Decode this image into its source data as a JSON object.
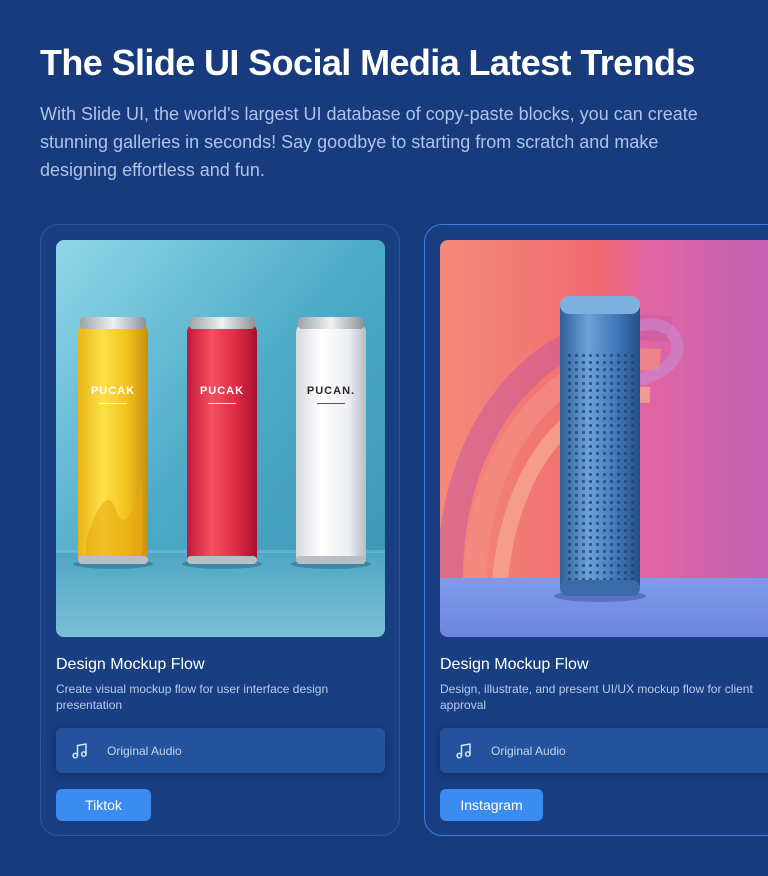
{
  "header": {
    "title": "The Slide UI Social Media Latest Trends",
    "description": "With Slide UI, the world's largest UI database of copy-paste blocks, you can create stunning galleries in seconds! Say goodbye to starting from scratch and make designing effortless and fun."
  },
  "cards": [
    {
      "title": "Design Mockup Flow",
      "description": "Create visual mockup flow for user interface design presentation",
      "audio_label": "Original Audio",
      "tag_label": "Tiktok",
      "image_labels": [
        "PUCAK",
        "PUCAK",
        "PUCAN."
      ]
    },
    {
      "title": "Design Mockup Flow",
      "description": "Design, illustrate, and present UI/UX mockup flow for client approval",
      "audio_label": "Original Audio",
      "tag_label": "Instagram"
    }
  ],
  "colors": {
    "background": "#183B7D",
    "accent": "#3B8CF0",
    "active_border": "#3E7FE3"
  },
  "icons": [
    "music-note-icon"
  ]
}
